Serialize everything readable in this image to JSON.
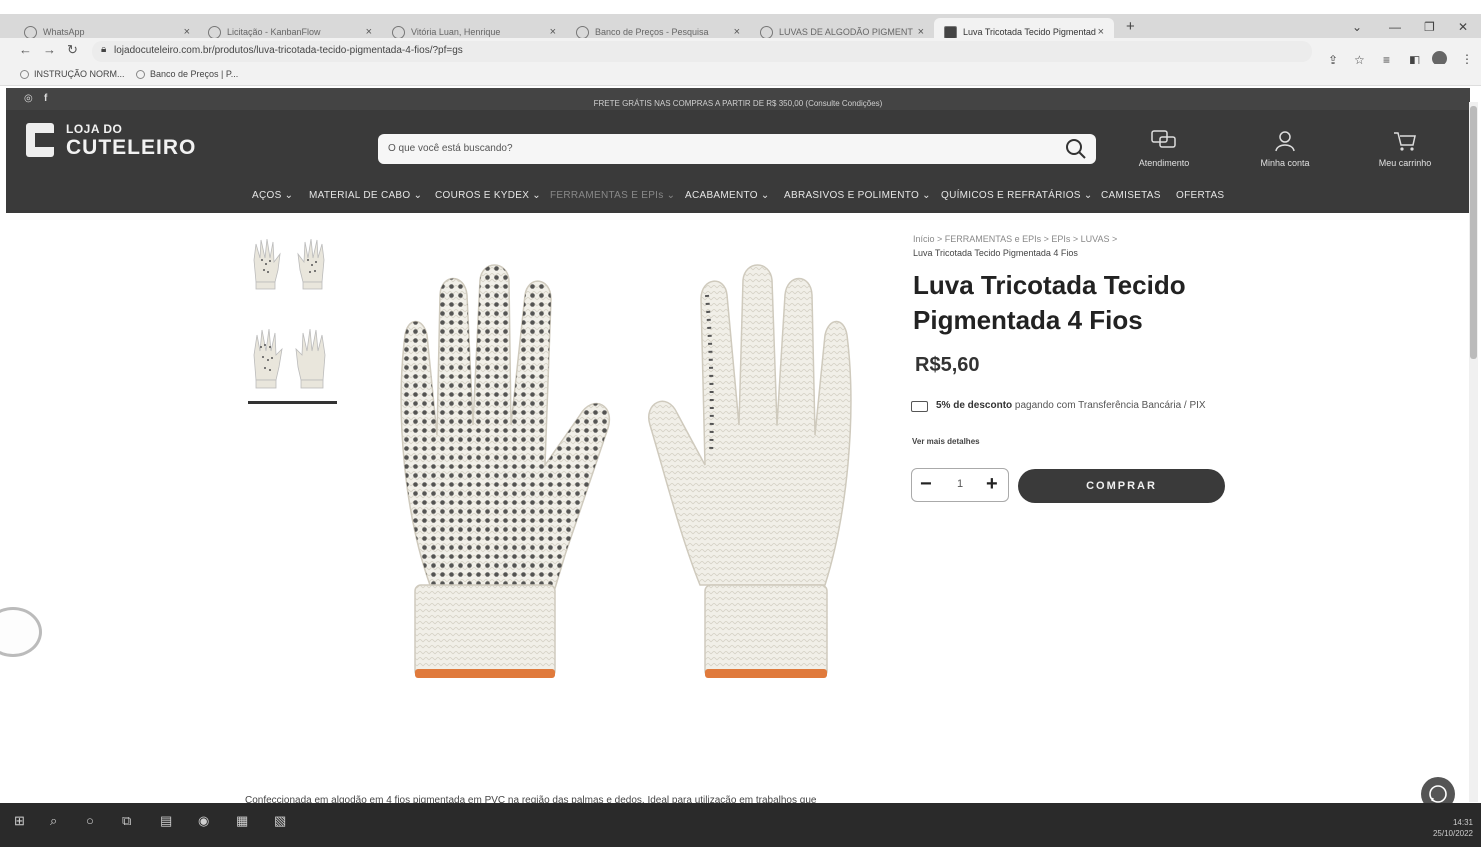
{
  "browser": {
    "tabs": [
      {
        "label": "WhatsApp"
      },
      {
        "label": "Licitação - KanbanFlow"
      },
      {
        "label": "Vitória Luan, Henrique"
      },
      {
        "label": "Banco de Preços - Pesquisa"
      },
      {
        "label": "LUVAS DE ALGODÃO PIGMENT"
      },
      {
        "label": "Luva Tricotada Tecido Pigmentad"
      }
    ],
    "new_tab": "+",
    "url": "lojadocuteleiro.com.br/produtos/luva-tricotada-tecido-pigmentada-4-fios/?pf=gs",
    "bookmarks": [
      "INSTRUÇÃO NORM...",
      "Banco de Preços | P..."
    ]
  },
  "site": {
    "promo": "FRETE GRÁTIS NAS COMPRAS A PARTIR DE R$ 350,00 (Consulte Condições)",
    "logo_line1": "LOJA DO",
    "logo_line2": "CUTELEIRO",
    "search_placeholder": "O que você está buscando?",
    "header_actions": {
      "support": "Atendimento",
      "account": "Minha conta",
      "cart": "Meu carrinho"
    },
    "menu": [
      "AÇOS ⌄",
      "MATERIAL DE CABO ⌄",
      "COUROS E KYDEX ⌄",
      "FERRAMENTAS E EPIs ⌄",
      "ACABAMENTO ⌄",
      "ABRASIVOS E POLIMENTO ⌄",
      "QUÍMICOS E REFRATÁRIOS ⌄",
      "CAMISETAS",
      "OFERTAS"
    ]
  },
  "product": {
    "breadcrumb_path": "Início > FERRAMENTAS e EPIs > EPIs > LUVAS >",
    "breadcrumb_current": "Luva Tricotada Tecido Pigmentada 4 Fios",
    "title": "Luva Tricotada Tecido Pigmentada 4 Fios",
    "price": "R$5,60",
    "discount_bold": "5% de desconto",
    "discount_rest": "pagando com Transferência Bancária / PIX",
    "details_link": "Ver mais detalhes",
    "quantity": "1",
    "buy_label": "COMPRAR",
    "description": "Confeccionada em algodão em 4 fios pigmentada em PVC na região das palmas e dedos. Ideal para utilização em trabalhos que"
  },
  "taskbar": {
    "time": "14:31",
    "date": "25/10/2022"
  },
  "colors": {
    "header_bg": "#3a3a3a",
    "button_bg": "#3a3a3a",
    "page_bg": "#ffffff"
  }
}
